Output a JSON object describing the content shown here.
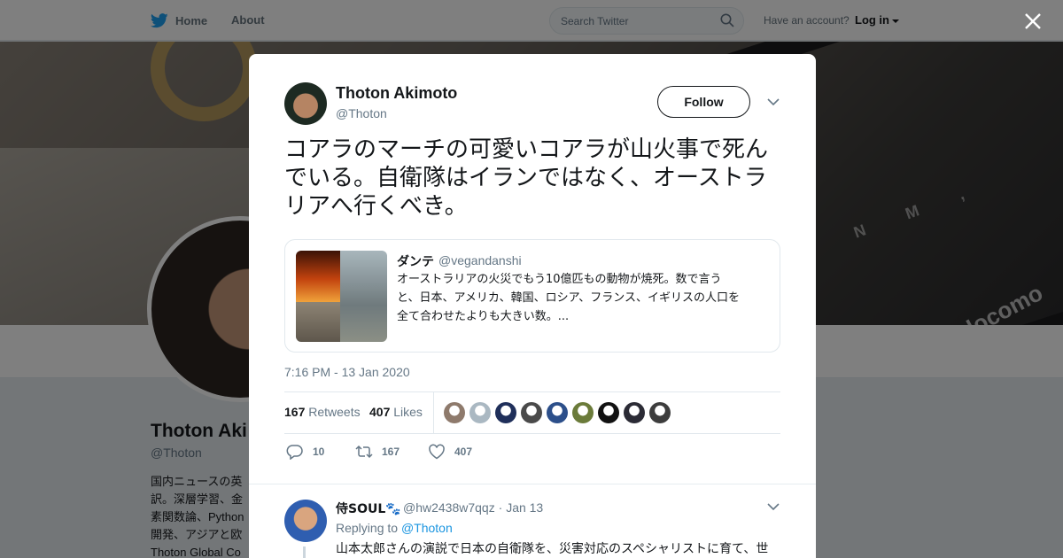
{
  "topbar": {
    "home_label": "Home",
    "about_label": "About",
    "search_placeholder": "Search Twitter",
    "have_account": "Have an account?",
    "login_label": "Log in"
  },
  "banner": {
    "brand_text": "docomo",
    "keys_text": "N M ,"
  },
  "profile": {
    "name": "Thoton Aki",
    "handle": "@Thoton",
    "bio_lines": [
      "国内ニュースの英",
      "訳。深層学習、金",
      "素関数論、Python",
      "開発、アジアと欧",
      "Thoton Global Co"
    ]
  },
  "tweet": {
    "author_name": "Thoton Akimoto",
    "author_handle": "@Thoton",
    "follow_label": "Follow",
    "text": "コアラのマーチの可愛いコアラが山火事で死んでいる。自衛隊はイランではなく、オーストラリアへ行くべき。",
    "quote": {
      "name": "ダンテ",
      "handle": "@vegandanshi",
      "lines": [
        "オーストラリアの火災でもう10億匹もの動物が焼死。数で言う",
        "と、日本、アメリカ、韓国、ロシア、フランス、イギリスの人口を",
        "全て合わせたよりも大きい数。..."
      ]
    },
    "timestamp": "7:16 PM - 13 Jan 2020",
    "retweets_count": "167",
    "retweets_label": "Retweets",
    "likes_count": "407",
    "likes_label": "Likes",
    "likers_colors": [
      "#8e7a6c",
      "#aab8c2",
      "#1f2f5a",
      "#4a4a4a",
      "#2c4f8a",
      "#6b7b3a",
      "#111111",
      "#2b2b35",
      "#3d3d3d"
    ],
    "actions": {
      "replies": "10",
      "retweets": "167",
      "likes": "407"
    }
  },
  "reply": {
    "name": "侍SOUL🐾",
    "handle": "@hw2438w7qqz",
    "separator": "·",
    "date": "Jan 13",
    "replying_prefix": "Replying to",
    "replying_to": "@Thoton",
    "text": "山本太郎さんの演説で日本の自衛隊を、災害対応のスペシャリストに育て、世"
  },
  "colors": {
    "brand_blue": "#1da1f2",
    "link_blue": "#1b95e0",
    "text_dark": "#14171a",
    "text_gray": "#657786"
  }
}
